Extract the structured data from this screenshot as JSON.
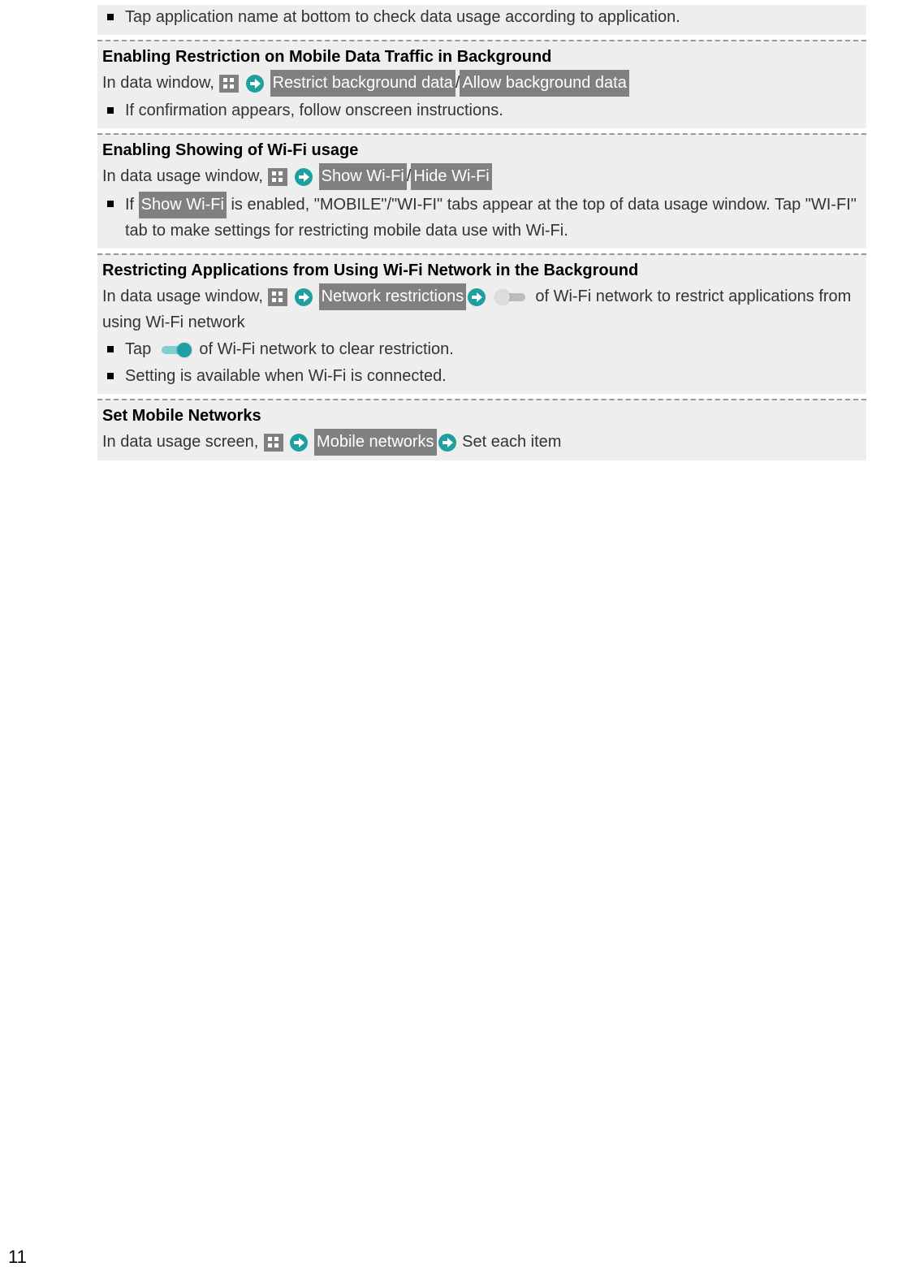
{
  "sections": {
    "top_bullet": "Tap application name at bottom to check data usage according to application.",
    "s1": {
      "heading": "Enabling Restriction on Mobile Data Traffic in Background",
      "line_prefix": "In data window, ",
      "btn_a": "Restrict background data",
      "sep": "/",
      "btn_b": "Allow background data",
      "bullet": "If confirmation appears, follow onscreen instructions."
    },
    "s2": {
      "heading": "Enabling Showing of Wi-Fi usage",
      "line_prefix": "In data usage window, ",
      "btn_a": "Show Wi-Fi",
      "sep": "/",
      "btn_b": "Hide Wi-Fi",
      "bullet_pre": "If ",
      "bullet_btn": "Show Wi-Fi",
      "bullet_post": " is enabled, \"MOBILE\"/\"WI-FI\" tabs appear at the top of data usage window. Tap \"WI-FI\" tab to make settings for restricting mobile data use with Wi-Fi."
    },
    "s3": {
      "heading": "Restricting Applications from Using Wi-Fi Network in the Background",
      "line_prefix": "In data usage window, ",
      "btn_a": "Network restrictions",
      "line_suffix": " of Wi-Fi network to restrict applications from using Wi-Fi network",
      "bullet1_pre": "Tap ",
      "bullet1_post": " of Wi-Fi network to clear restriction.",
      "bullet2": "Setting is available when Wi-Fi is connected."
    },
    "s4": {
      "heading": "Set Mobile Networks",
      "line_prefix": "In data usage screen, ",
      "btn_a": "Mobile networks",
      "line_suffix": " Set each item"
    }
  },
  "page_number": "11"
}
